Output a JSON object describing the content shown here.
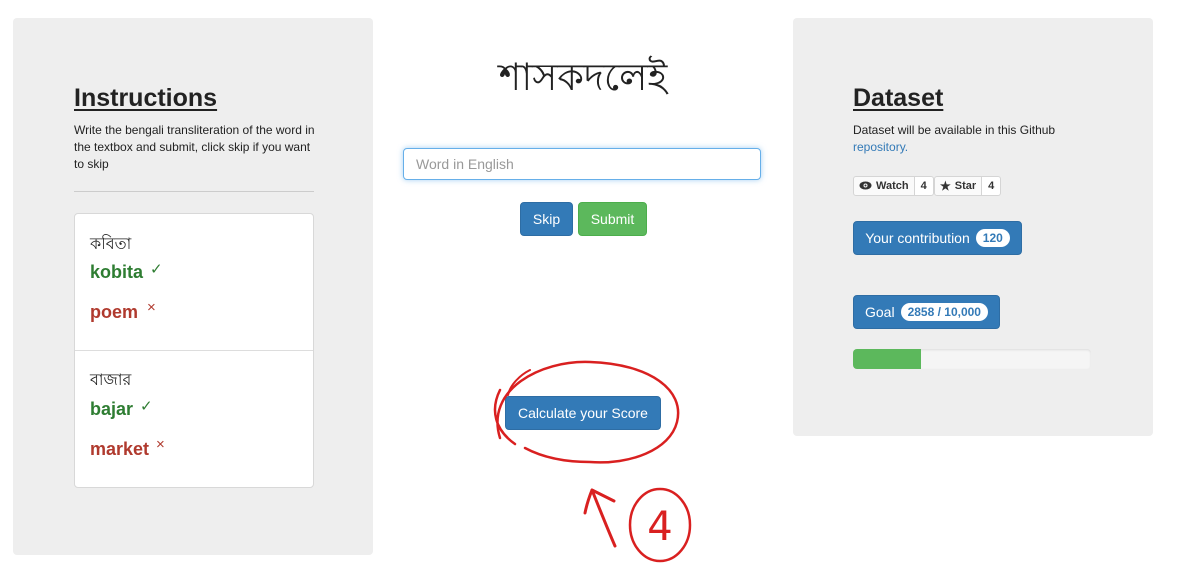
{
  "instructions": {
    "title": "Instructions",
    "text": "Write the bengali transliteration of the word in the textbox and submit, click skip if you want to skip",
    "examples": [
      {
        "bengali": "কবিতা",
        "correct": "kobita",
        "wrong": "poem"
      },
      {
        "bengali": "বাজার",
        "correct": "bajar",
        "wrong": "market"
      }
    ],
    "check_glyph": "✓",
    "cross_glyph": "×"
  },
  "main": {
    "word": "শাসকদলেই",
    "input_placeholder": "Word in English",
    "input_value": "",
    "skip_label": "Skip",
    "submit_label": "Submit",
    "score_label": "Calculate your Score",
    "annotation_number": "4"
  },
  "dataset": {
    "title": "Dataset",
    "text": "Dataset will be available in this Github",
    "link_text": "repository.",
    "watch_label": "Watch",
    "watch_count": "4",
    "star_label": "Star",
    "star_count": "4",
    "contribution_label": "Your contribution",
    "contribution_count": "120",
    "goal_label": "Goal",
    "goal_value": "2858 / 10,000",
    "goal_progress": 0.2858
  },
  "colors": {
    "primary": "#337ab7",
    "success": "#5cb85c",
    "correct_text": "#2e7d32",
    "wrong_text": "#b03a2e",
    "annotation": "#d92020",
    "panel_bg": "#eeeeee"
  },
  "icons": {
    "watch": "eye-icon",
    "star": "star-icon",
    "check": "check-icon",
    "cross": "cross-icon"
  }
}
